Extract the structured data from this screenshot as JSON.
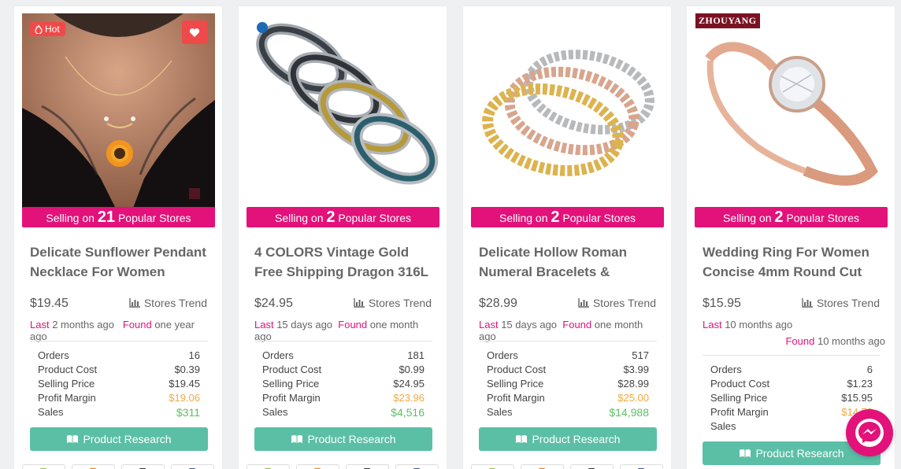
{
  "labels": {
    "selling_on": "Selling on",
    "popular_stores": "Popular Stores",
    "stores_trend": "Stores Trend",
    "last": "Last",
    "found": "Found",
    "orders": "Orders",
    "product_cost": "Product Cost",
    "selling_price": "Selling Price",
    "profit_margin": "Profit Margin",
    "sales": "Sales",
    "product_research": "Product Research",
    "hot": "Hot"
  },
  "products": [
    {
      "stores": "21",
      "title": "Delicate Sunflower Pendant Necklace For Women Creative",
      "price": "$19.45",
      "last": "2 months ago",
      "found": "one year ago",
      "orders": "16",
      "cost": "$0.39",
      "selling": "$19.45",
      "margin": "$19.06",
      "sales": "$311"
    },
    {
      "stores": "2",
      "title": "4 COLORS Vintage Gold Free Shipping Dragon 316L",
      "price": "$24.95",
      "last": "15 days ago",
      "found": "one month ago",
      "orders": "181",
      "cost": "$0.99",
      "selling": "$24.95",
      "margin": "$23.96",
      "sales": "$4,516"
    },
    {
      "stores": "2",
      "title": "Delicate Hollow Roman Numeral Bracelets & Bangles",
      "price": "$28.99",
      "last": "15 days ago",
      "found": "one month ago",
      "orders": "517",
      "cost": "$3.99",
      "selling": "$28.99",
      "margin": "$25.00",
      "sales": "$14,988"
    },
    {
      "stores": "2",
      "title": "Wedding Ring For Women Concise 4mm Round Cut",
      "price": "$15.95",
      "last": "10 months ago",
      "found": "10 months ago",
      "orders": "6",
      "cost": "$1.23",
      "selling": "$15.95",
      "margin": "$14.72",
      "sales": ""
    }
  ],
  "brand_logo": "ZHOUYANG",
  "colors": {
    "accent": "#e2127a",
    "button": "#5bbfa6",
    "hot": "#ef4a4a",
    "margin": "#f3a840",
    "sales": "#5cbf64"
  }
}
